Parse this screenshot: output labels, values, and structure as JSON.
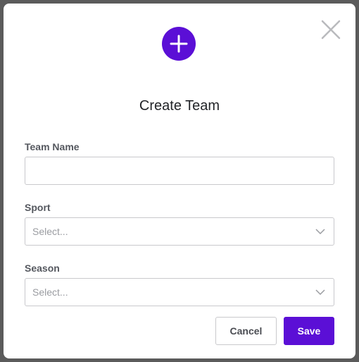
{
  "modal": {
    "title": "Create Team"
  },
  "fields": {
    "team_name": {
      "label": "Team Name",
      "value": "",
      "placeholder": ""
    },
    "sport": {
      "label": "Sport",
      "selected": "Select..."
    },
    "season": {
      "label": "Season",
      "selected": "Select..."
    }
  },
  "actions": {
    "cancel_label": "Cancel",
    "save_label": "Save"
  },
  "icons": {
    "header": "plus-icon",
    "close": "close-icon",
    "dropdown": "chevron-down-icon"
  },
  "colors": {
    "accent": "#5b0fd6",
    "backdrop": "#5b5b5b",
    "surface": "#ffffff",
    "border": "#c9c9cc",
    "placeholder_text": "#9a9ca1"
  }
}
